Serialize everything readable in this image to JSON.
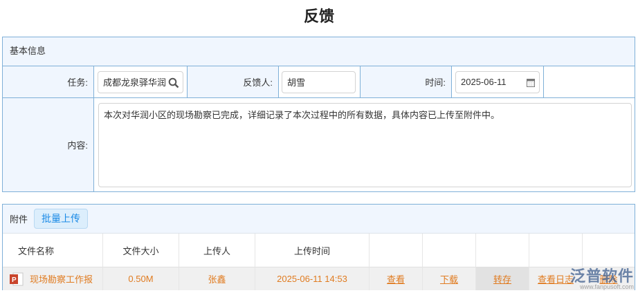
{
  "title": "反馈",
  "basic": {
    "header": "基本信息",
    "task_label": "任务:",
    "task_value": "成都龙泉驿华润",
    "feedback_person_label": "反馈人:",
    "feedback_person_value": "胡雪",
    "time_label": "时间:",
    "time_value": "2025-06-11",
    "content_label": "内容:",
    "content_value": "本次对华润小区的现场勘察已完成，详细记录了本次过程中的所有数据，具体内容已上传至附件中。"
  },
  "attachments": {
    "header": "附件",
    "upload_button": "批量上传",
    "columns": [
      "文件名称",
      "文件大小",
      "上传人",
      "上传时间"
    ],
    "rows": [
      {
        "name": "现场勘察工作报",
        "size": "0.50M",
        "uploader": "张鑫",
        "time": "2025-06-11 14:53",
        "actions": [
          "查看",
          "下载",
          "转存",
          "查看日志",
          "删除"
        ]
      }
    ]
  },
  "watermark": {
    "brand": "泛普软件",
    "url": "www.fanpusoft.com"
  },
  "colors": {
    "accent": "#1a8ae6",
    "link": "#e07b20",
    "border": "#7fb0d8"
  }
}
